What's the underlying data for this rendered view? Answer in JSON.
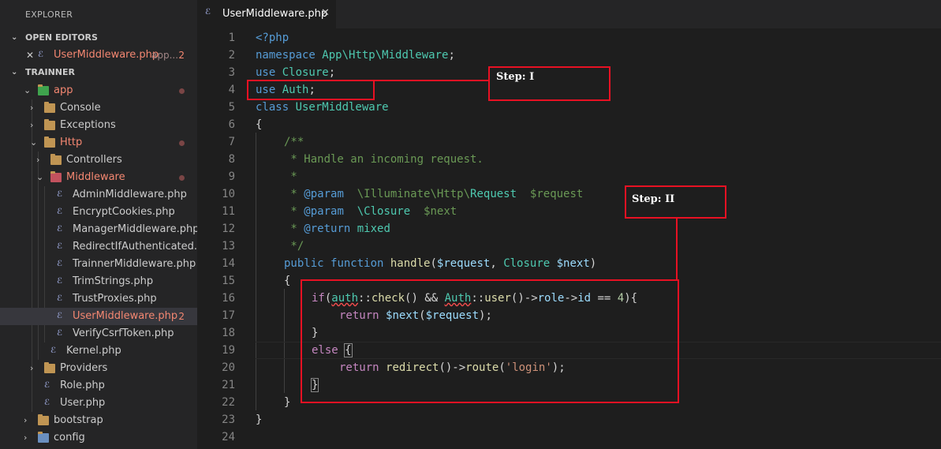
{
  "sidebar": {
    "title": "EXPLORER",
    "open_editors_label": "OPEN EDITORS",
    "open_editor": {
      "close": "✕",
      "name": "UserMiddleware.php",
      "path": "app...",
      "badge": "2"
    },
    "project_label": "TRAINNER",
    "tree": {
      "app": "app",
      "console": "Console",
      "exceptions": "Exceptions",
      "http": "Http",
      "controllers": "Controllers",
      "middleware": "Middleware",
      "mw_files": [
        "AdminMiddleware.php",
        "EncryptCookies.php",
        "ManagerMiddleware.php",
        "RedirectIfAuthenticated.p...",
        "TrainnerMiddleware.php",
        "TrimStrings.php",
        "TrustProxies.php",
        "UserMiddleware.php",
        "VerifyCsrfToken.php"
      ],
      "selected_badge": "2",
      "kernel": "Kernel.php",
      "providers": "Providers",
      "role": "Role.php",
      "user": "User.php",
      "bootstrap": "bootstrap",
      "config": "config"
    }
  },
  "tab": {
    "name": "UserMiddleware.php",
    "close": "✕",
    "icon": "php-elephant-icon"
  },
  "line_numbers": [
    "1",
    "2",
    "3",
    "4",
    "5",
    "6",
    "7",
    "8",
    "9",
    "10",
    "11",
    "12",
    "13",
    "14",
    "15",
    "16",
    "17",
    "18",
    "19",
    "20",
    "21",
    "22",
    "23",
    "24"
  ],
  "code": {
    "l1": "<?php",
    "l2": [
      "namespace ",
      "App\\Http\\Middleware",
      ";"
    ],
    "l3": [
      "use ",
      "Closure",
      ";"
    ],
    "l4": [
      "use ",
      "Auth",
      ";"
    ],
    "l5": [
      "class ",
      "UserMiddleware"
    ],
    "l6": "{",
    "l7": "/**",
    "l8": " * Handle an incoming request.",
    "l9": " *",
    "l10": [
      " * ",
      "@param",
      "  \\Illuminate\\Http\\",
      "Request",
      "  ",
      "$request"
    ],
    "l11": [
      " * ",
      "@param",
      "  \\Closure",
      "  ",
      "$next"
    ],
    "l12": [
      " * ",
      "@return",
      " mixed"
    ],
    "l13": " */",
    "l14": [
      "public ",
      "function ",
      "handle",
      "(",
      "$request",
      ", ",
      "Closure ",
      "$next",
      ")"
    ],
    "l15": "{",
    "l16": [
      "if",
      "(",
      "auth",
      "::",
      "check",
      "() && ",
      "Auth",
      "::",
      "user",
      "()->",
      "role",
      "->",
      "id",
      " == ",
      "4",
      "){"
    ],
    "l17": [
      "return ",
      "$next",
      "(",
      "$request",
      ");"
    ],
    "l18": "}",
    "l19": [
      "else ",
      "{"
    ],
    "l20": [
      "return ",
      "redirect",
      "()->",
      "route",
      "(",
      "'login'",
      ");"
    ],
    "l21": "}",
    "l22": "}",
    "l23": "}",
    "l24": ""
  },
  "annotations": {
    "step1": "Step: I",
    "step2": "Step: II",
    "color": "#e81123"
  }
}
